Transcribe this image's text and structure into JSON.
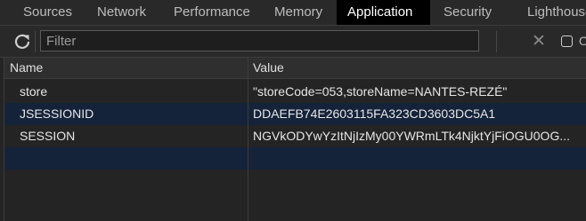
{
  "tabs": [
    {
      "label": "Sources",
      "active": false
    },
    {
      "label": "Network",
      "active": false
    },
    {
      "label": "Performance",
      "active": false
    },
    {
      "label": "Memory",
      "active": false
    },
    {
      "label": "Application",
      "active": true
    },
    {
      "label": "Security",
      "active": false
    },
    {
      "label": "Lighthouse",
      "active": false
    }
  ],
  "toolbar": {
    "filter_placeholder": "Filter",
    "checkbox_label": "O"
  },
  "table": {
    "headers": {
      "name": "Name",
      "value": "Value"
    },
    "rows": [
      {
        "name": "store",
        "value": "\"storeCode=053,storeName=NANTES-REZÉ\""
      },
      {
        "name": "JSESSIONID",
        "value": "DDAEFB74E2603115FA323CD3603DC5A1"
      },
      {
        "name": "SESSION",
        "value": "NGVkODYwYzItNjIzMy00YWRmLTk4NjktYjFiOGU0OG..."
      },
      {
        "name": "",
        "value": ""
      }
    ]
  },
  "colors": {
    "active_tab_bg": "#000000",
    "selected_row_bg": "#15233a",
    "background": "#242424"
  }
}
